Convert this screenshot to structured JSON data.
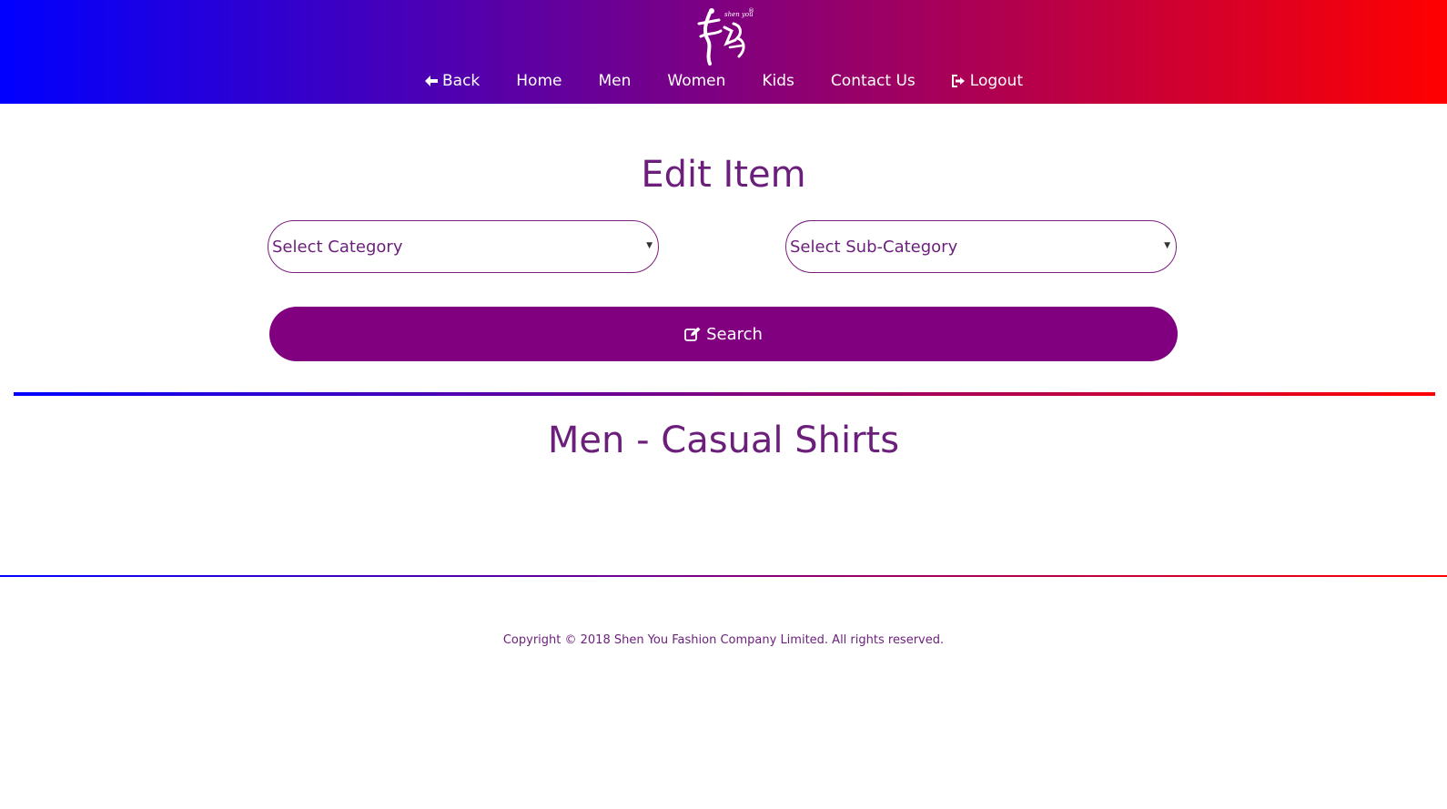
{
  "header": {
    "logo_text": "shen you",
    "nav": [
      {
        "label": "Back",
        "icon": "arrow-left-icon"
      },
      {
        "label": "Home"
      },
      {
        "label": "Men"
      },
      {
        "label": "Women"
      },
      {
        "label": "Kids"
      },
      {
        "label": "Contact Us"
      },
      {
        "label": "Logout",
        "icon": "sign-out-icon"
      }
    ]
  },
  "main": {
    "title": "Edit Item",
    "category_select": {
      "value": "Select Category"
    },
    "subcategory_select": {
      "value": "Select Sub-Category"
    },
    "search_button": {
      "label": "Search",
      "icon": "edit-icon"
    },
    "section_title": "Men - Casual Shirts"
  },
  "footer": {
    "copyright": "Copyright © 2018 Shen You Fashion Company Limited. All rights reserved."
  },
  "colors": {
    "gradient_start": "#0000ff",
    "gradient_mid": "#800080",
    "gradient_end": "#ff0000",
    "accent": "#800080",
    "text": "#6b1f7b"
  }
}
